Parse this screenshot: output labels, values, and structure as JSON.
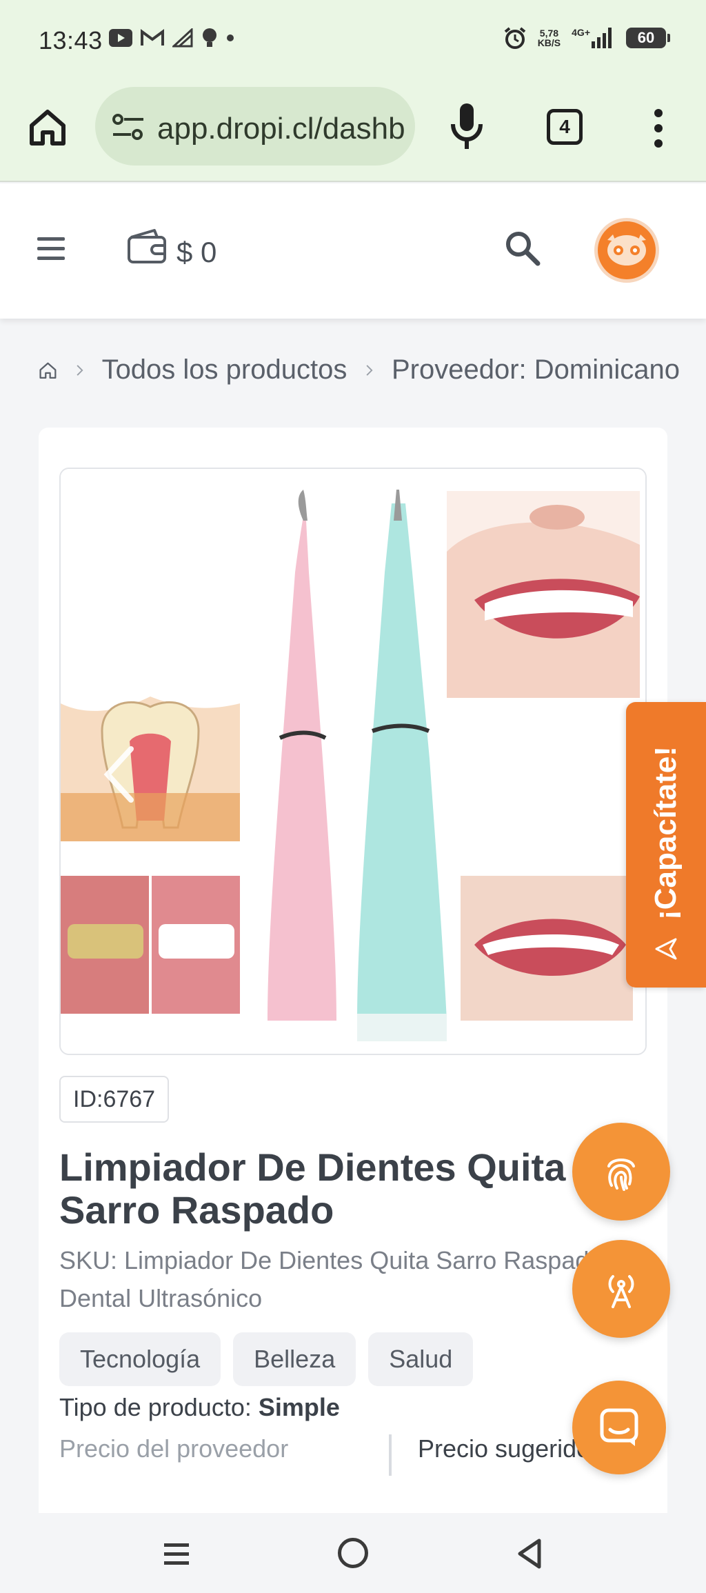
{
  "status_bar": {
    "time": "13:43",
    "net_speed_top": "5,78",
    "net_speed_unit": "KB/S",
    "network_type": "4G+",
    "battery": "60"
  },
  "browser": {
    "url": "app.dropi.cl/dashboard",
    "tab_count": "4"
  },
  "header": {
    "wallet_amount": "$ 0"
  },
  "breadcrumb": {
    "items": [
      "Todos los productos",
      "Proveedor: Dominicano"
    ]
  },
  "product": {
    "id_label": "ID:6767",
    "title": "Limpiador De Dientes Quita Sarro Raspado",
    "sku": "SKU: Limpiador De Dientes Quita Sarro Raspado Dental Ultrasónico",
    "tags": [
      "Tecnología",
      "Belleza",
      "Salud"
    ],
    "type_label": "Tipo de producto:",
    "type_value": "Simple",
    "price_provider_label": "Precio del proveedor",
    "price_suggested_label": "Precio sugerido"
  },
  "side_tab": {
    "label": "¡Capacítate!"
  },
  "colors": {
    "accent": "#f49437",
    "side_tab": "#ef7a2a",
    "browser_bg": "#eaf6e4"
  },
  "icons": {
    "home": "home-icon",
    "search": "search-icon",
    "wallet": "wallet-icon",
    "fingerprint": "fingerprint-icon",
    "antenna": "antenna-icon",
    "chat": "chat-icon"
  }
}
